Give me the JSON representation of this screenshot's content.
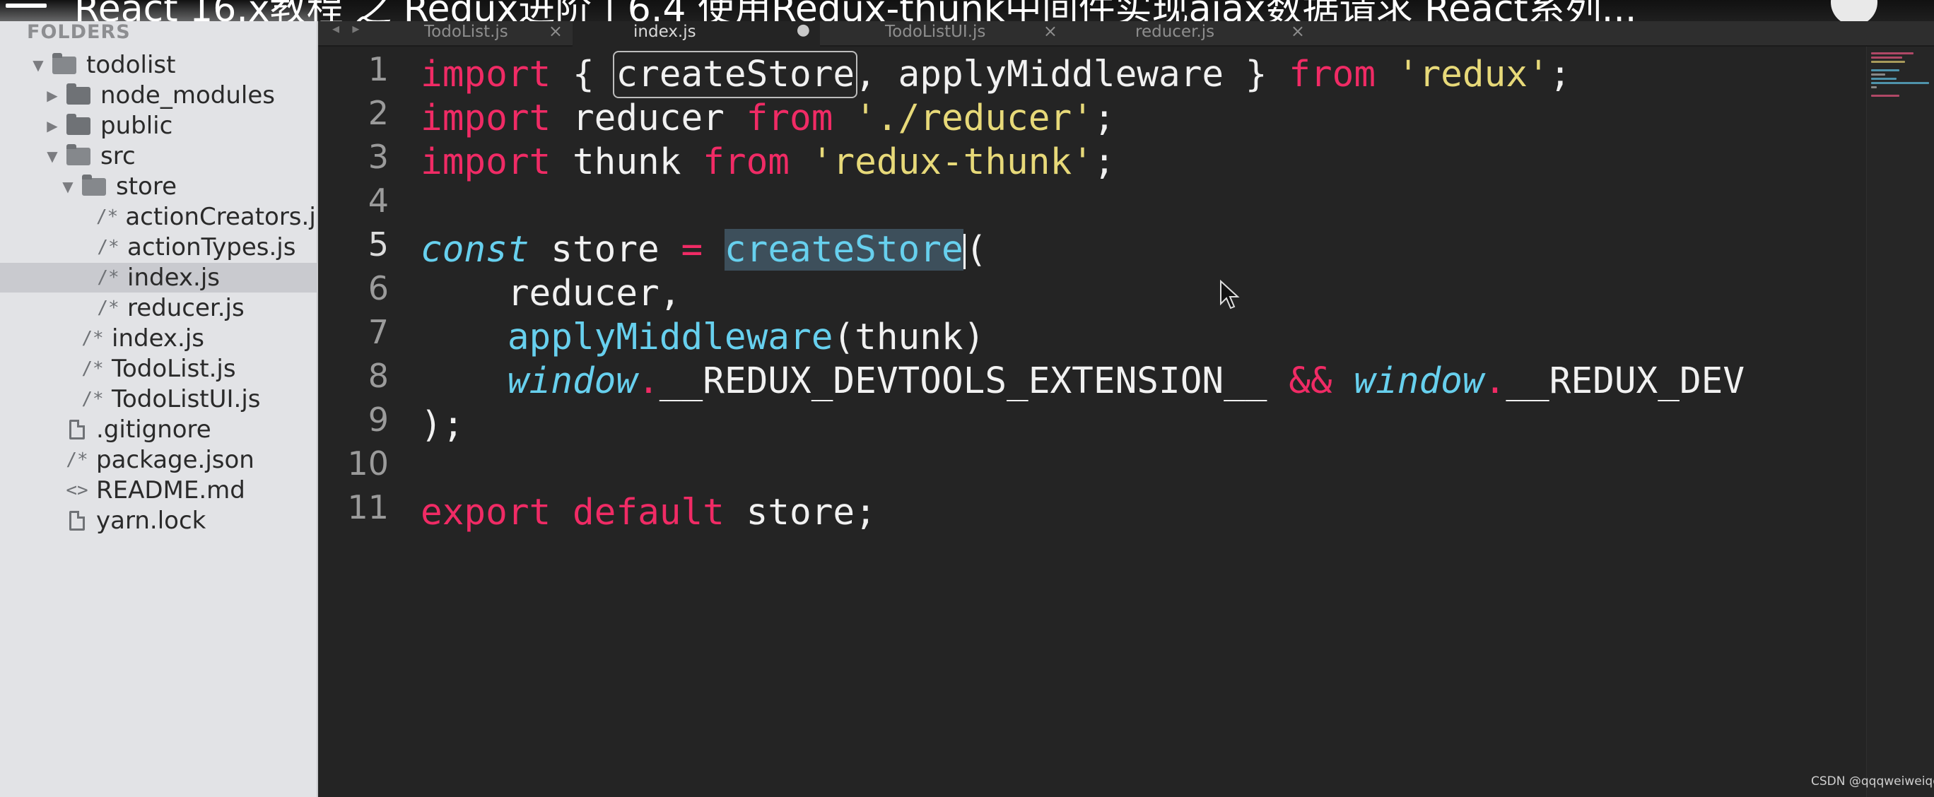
{
  "video_title": "React 16.x教程 之 Redux进阶 | 6.4 使用Redux-thunk中间件实现ajax数据请求        React系列...",
  "sidebar": {
    "heading": "FOLDERS",
    "items": [
      {
        "label": "todolist",
        "type": "folder-open"
      },
      {
        "label": "node_modules",
        "type": "folder"
      },
      {
        "label": "public",
        "type": "folder"
      },
      {
        "label": "src",
        "type": "folder-open"
      },
      {
        "label": "store",
        "type": "folder-open"
      },
      {
        "label": "actionCreators.js",
        "type": "js"
      },
      {
        "label": "actionTypes.js",
        "type": "js"
      },
      {
        "label": "index.js",
        "type": "js",
        "selected": true
      },
      {
        "label": "reducer.js",
        "type": "js"
      },
      {
        "label": "index.js",
        "type": "js"
      },
      {
        "label": "TodoList.js",
        "type": "js"
      },
      {
        "label": "TodoListUI.js",
        "type": "js"
      },
      {
        "label": ".gitignore",
        "type": "doc"
      },
      {
        "label": "package.json",
        "type": "js"
      },
      {
        "label": "README.md",
        "type": "md"
      },
      {
        "label": "yarn.lock",
        "type": "doc"
      }
    ]
  },
  "tabs": [
    {
      "label": "TodoList.js",
      "close": "×"
    },
    {
      "label": "index.js",
      "close": "●",
      "active": true
    },
    {
      "label": "TodoListUI.js",
      "close": "×"
    },
    {
      "label": "reducer.js",
      "close": "×"
    }
  ],
  "tab_nav": "◂ ▸",
  "line_numbers": [
    "1",
    "2",
    "3",
    "4",
    "5",
    "6",
    "7",
    "8",
    "9",
    "10",
    "11"
  ],
  "current_line": "5",
  "code": {
    "l1": {
      "t1": "import",
      "t2": " { ",
      "t3": "createStore",
      "t4": ", applyMiddleware } ",
      "t5": "from",
      "t6": " ",
      "t7": "'redux'",
      "t8": ";"
    },
    "l2": {
      "t1": "import",
      "t2": " reducer ",
      "t3": "from",
      "t4": " ",
      "t5": "'./reducer'",
      "t6": ";"
    },
    "l3": {
      "t1": "import",
      "t2": " thunk ",
      "t3": "from",
      "t4": " ",
      "t5": "'redux-thunk'",
      "t6": ";"
    },
    "l5": {
      "t1": "const",
      "t2": " store ",
      "t3": "=",
      "t4": " ",
      "t5": "createStore",
      "t6": "("
    },
    "l6": {
      "t1": "    reducer,"
    },
    "l7": {
      "t1": "    ",
      "t2": "applyMiddleware",
      "t3": "(thunk)"
    },
    "l8": {
      "t1": "    ",
      "t2": "window",
      "t3": ".",
      "t4": "__REDUX_DEVTOOLS_EXTENSION__ ",
      "t5": "&&",
      "t6": " ",
      "t7": "window",
      "t8": ".",
      "t9": "__REDUX_DEV"
    },
    "l9": {
      "t1": ");"
    },
    "l11": {
      "t1": "export",
      "t2": " ",
      "t3": "default",
      "t4": " store;"
    }
  },
  "watermark": "CSDN @qqqweiweiqq",
  "colors": {
    "keyword": "#f02b65",
    "string": "#e7d979",
    "function": "#67d0ee",
    "background": "#242424",
    "sidebar": "#e2e3e6"
  }
}
